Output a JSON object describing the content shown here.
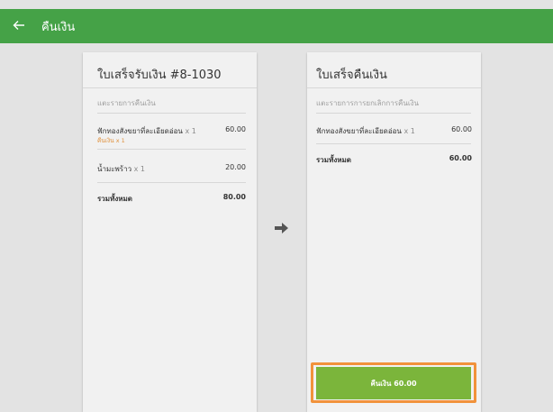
{
  "header": {
    "title": "คืนเงิน",
    "back_icon": "arrow-left-icon"
  },
  "receipt": {
    "title": "ใบเสร็จรับเงิน #8-1030",
    "subtitle": "แตะรายการคืนเงิน",
    "items": [
      {
        "name": "ฟักทองสังขยาที่ละเอียดอ่อน",
        "qty": "x 1",
        "price": "60.00",
        "note": "คืนเงิน x 1"
      },
      {
        "name": "น้ำมะพร้าว",
        "qty": "x 1",
        "price": "20.00"
      }
    ],
    "total_label": "รวมทั้งหมด",
    "total_value": "80.00"
  },
  "refund_receipt": {
    "title": "ใบเสร็จคืนเงิน",
    "subtitle": "แตะรายการการยกเลิกการคืนเงิน",
    "items": [
      {
        "name": "ฟักทองสังขยาที่ละเอียดอ่อน",
        "qty": "x 1",
        "price": "60.00"
      }
    ],
    "total_label": "รวมทั้งหมด",
    "total_value": "60.00",
    "refund_button": "คืนเงิน 60.00"
  },
  "colors": {
    "header": "#45a247",
    "button": "#7bb53b",
    "highlight": "#f1923b",
    "note": "#e0913c"
  },
  "icons": {
    "transfer": "arrow-right-icon"
  }
}
